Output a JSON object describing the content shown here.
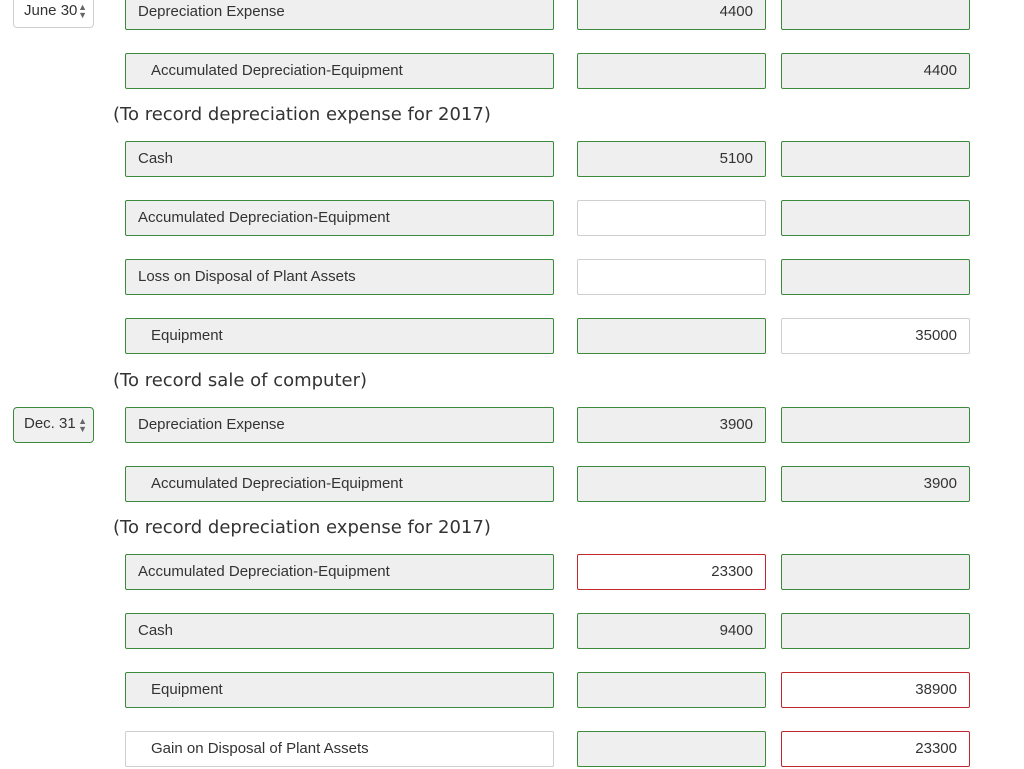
{
  "rows": [
    {
      "date": "June 30",
      "account": "Depreciation Expense",
      "debit": "4400",
      "credit": ""
    },
    {
      "account": "Accumulated Depreciation-Equipment",
      "debit": "",
      "credit": "4400"
    },
    {
      "account": "Cash",
      "debit": "5100",
      "credit": ""
    },
    {
      "account": "Accumulated Depreciation-Equipment",
      "debit": "",
      "credit": ""
    },
    {
      "account": "Loss on Disposal of Plant Assets",
      "debit": "",
      "credit": ""
    },
    {
      "account": "Equipment",
      "debit": "",
      "credit": "35000"
    },
    {
      "date": "Dec. 31",
      "account": "Depreciation Expense",
      "debit": "3900",
      "credit": ""
    },
    {
      "account": "Accumulated Depreciation-Equipment",
      "debit": "",
      "credit": "3900"
    },
    {
      "account": "Accumulated Depreciation-Equipment",
      "debit": "23300",
      "credit": ""
    },
    {
      "account": "Cash",
      "debit": "9400",
      "credit": ""
    },
    {
      "account": "Equipment",
      "debit": "",
      "credit": "38900"
    },
    {
      "account": "Gain on Disposal of Plant Assets",
      "debit": "",
      "credit": "23300"
    }
  ],
  "notes": [
    "(To record depreciation expense for 2017)",
    "(To record sale of computer)",
    "(To record depreciation expense for 2017)"
  ],
  "icons": {
    "date_arrows": "up-down-arrows-icon"
  },
  "colors": {
    "correct_border": "#3c8a3c",
    "error_border": "#c0262d",
    "neutral_border": "#cfcfcf"
  }
}
